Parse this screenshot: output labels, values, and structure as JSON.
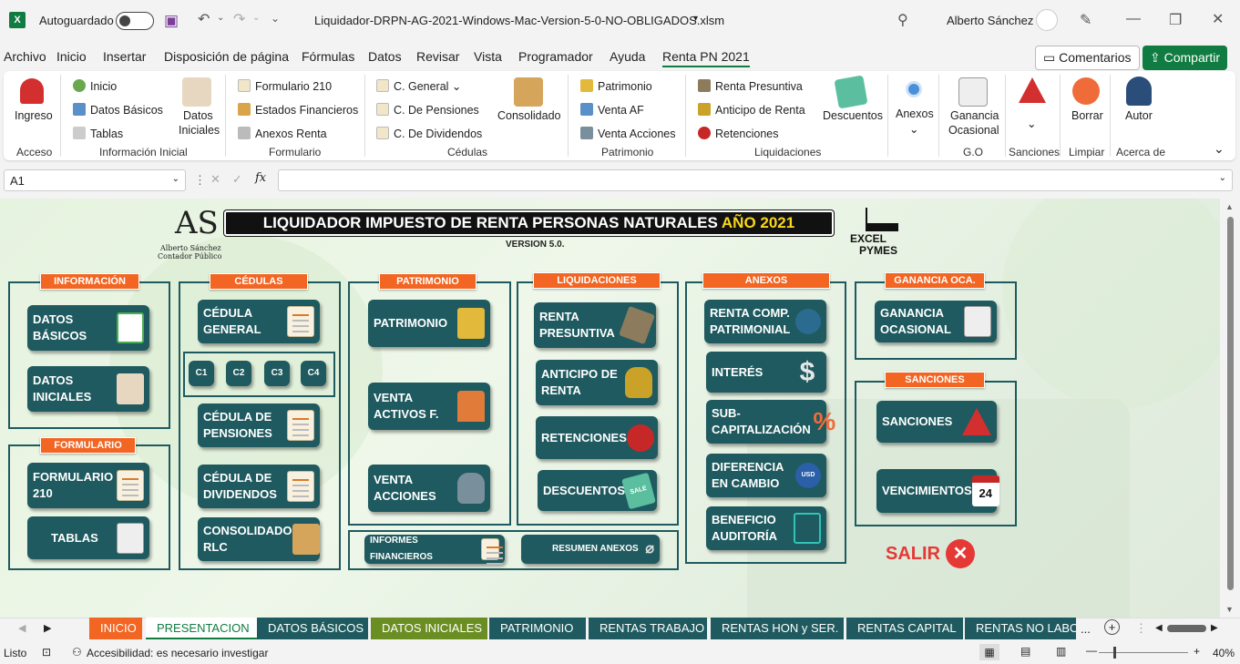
{
  "titlebar": {
    "autosave_label": "Autoguardado",
    "filename": "Liquidador-DRPN-AG-2021-Windows-Mac-Version-5-0-NO-OBLIGADOS.xlsm",
    "user": "Alberto Sánchez"
  },
  "menu": {
    "items": [
      "Archivo",
      "Inicio",
      "Insertar",
      "Disposición de página",
      "Fórmulas",
      "Datos",
      "Revisar",
      "Vista",
      "Programador",
      "Ayuda",
      "Renta PN 2021"
    ],
    "comments": "Comentarios",
    "share": "Compartir"
  },
  "ribbon": {
    "acceso": {
      "ingreso": "Ingreso",
      "group": "Acceso"
    },
    "info": {
      "inicio": "Inicio",
      "datos_basicos": "Datos Básicos",
      "tablas": "Tablas",
      "datos_iniciales_1": "Datos",
      "datos_iniciales_2": "Iniciales",
      "group": "Información Inicial"
    },
    "formulario": {
      "f210": "Formulario 210",
      "estados": "Estados Financieros",
      "anexos": "Anexos Renta",
      "group": "Formulario"
    },
    "cedulas": {
      "general": "C. General",
      "pensiones": "C. De Pensiones",
      "dividendos": "C. De Dividendos",
      "consolidado": "Consolidado",
      "group": "Cédulas"
    },
    "patrimonio": {
      "patrimonio": "Patrimonio",
      "venta_af": "Venta AF",
      "venta_acciones": "Venta Acciones",
      "group": "Patrimonio"
    },
    "liquidaciones": {
      "renta_presuntiva": "Renta Presuntiva",
      "anticipo": "Anticipo de Renta",
      "retenciones": "Retenciones",
      "descuentos": "Descuentos",
      "group": "Liquidaciones"
    },
    "anexos": {
      "label": "Anexos"
    },
    "go": {
      "l1": "Ganancia",
      "l2": "Ocasional",
      "group": "G.O"
    },
    "sanciones": {
      "group": "Sanciones"
    },
    "limpiar": {
      "borrar": "Borrar",
      "group": "Limpiar"
    },
    "acerca": {
      "autor": "Autor",
      "group": "Acerca de"
    }
  },
  "formula": {
    "cell": "A1",
    "fx": "fx",
    "value": ""
  },
  "sheet": {
    "logo_name": "Alberto Sánchez",
    "logo_sub": "Contador Público",
    "title_main": "LIQUIDADOR IMPUESTO DE RENTA PERSONAS NATURALES",
    "title_year": "AÑO 2021",
    "version": "VERSION 5.0.",
    "brand1": "EXCEL",
    "brand2": "PYMES",
    "headers": {
      "informacion": "INFORMACIÓN",
      "cedulas": "CÉDULAS",
      "patrimonio": "PATRIMONIO",
      "liquidaciones": "LIQUIDACIONES",
      "anexos": "ANEXOS",
      "ganancia": "GANANCIA OCA.",
      "formulario": "FORMULARIO",
      "sanciones": "SANCIONES"
    },
    "tiles": {
      "datos_basicos": "DATOS BÁSICOS",
      "datos_iniciales": "DATOS INICIALES",
      "formulario_210": "FORMULARIO 210",
      "tablas": "TABLAS",
      "cedula_general": "CÉDULA GENERAL",
      "c1": "C1",
      "c2": "C2",
      "c3": "C3",
      "c4": "C4",
      "cedula_pensiones": "CÉDULA DE PENSIONES",
      "cedula_dividendos": "CÉDULA DE DIVIDENDOS",
      "consolidado": "CONSOLIDADO RLC",
      "patrimonio": "PATRIMONIO",
      "venta_activos": "VENTA ACTIVOS F.",
      "venta_acciones": "VENTA ACCIONES",
      "renta_presuntiva": "RENTA PRESUNTIVA",
      "anticipo": "ANTICIPO DE RENTA",
      "retenciones": "RETENCIONES",
      "descuentos": "DESCUENTOS",
      "informes": "INFORMES FINANCIEROS",
      "resumen_anexos": "RESUMEN ANEXOS",
      "renta_comp": "RENTA COMP. PATRIMONIAL",
      "interes": "INTERÉS",
      "subcap": "SUB- CAPITALIZACIÓN",
      "diferencia": "DIFERENCIA EN CAMBIO",
      "beneficio": "BENEFICIO AUDITORÍA",
      "ganancia": "GANANCIA OCASIONAL",
      "sanciones": "SANCIONES",
      "vencimientos": "VENCIMIENTOS",
      "salir": "SALIR"
    },
    "usd": "USD",
    "cal_day": "24",
    "sale": "SALE"
  },
  "tabs": [
    {
      "label": "INICIO",
      "color": "#f26522"
    },
    {
      "label": "PRESENTACION",
      "color": "#ffffff"
    },
    {
      "label": "DATOS BÁSICOS",
      "color": "#1e5a5f"
    },
    {
      "label": "DATOS INICIALES",
      "color": "#6b8e23"
    },
    {
      "label": "PATRIMONIO",
      "color": "#1e5a5f"
    },
    {
      "label": "RENTAS TRABAJO",
      "color": "#1e5a5f"
    },
    {
      "label": "RENTAS HON y SER.",
      "color": "#1e5a5f"
    },
    {
      "label": "RENTAS CAPITAL",
      "color": "#1e5a5f"
    },
    {
      "label": "RENTAS NO LABOR",
      "color": "#1e5a5f"
    }
  ],
  "status": {
    "ready": "Listo",
    "accessibility": "Accesibilidad: es necesario investigar",
    "zoom": "40%"
  }
}
